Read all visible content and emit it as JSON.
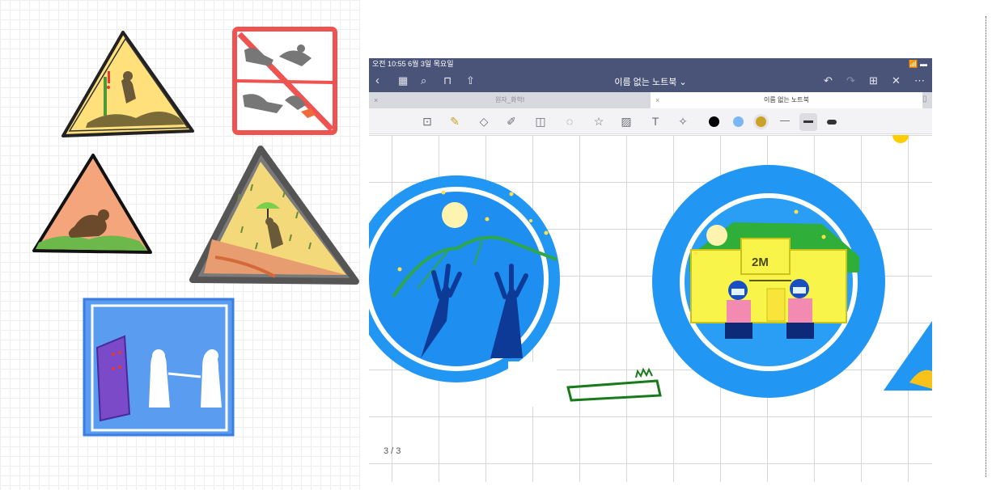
{
  "app": {
    "status_time": "오전 10:55  6월 3일 목요일",
    "status_right": "📶 ▬",
    "doc_title": "이름 없는 노트북 ⌄",
    "tabs": [
      {
        "label": "원자_화학I",
        "close": "×"
      },
      {
        "label": "이름 없는 노트북",
        "close": "×"
      }
    ],
    "page_counter": "3 / 3"
  },
  "nav_icons": {
    "left": [
      "back-icon",
      "grid-icon",
      "search-icon",
      "bookmark-icon",
      "share-icon"
    ],
    "right": [
      "undo-icon",
      "redo-icon",
      "add-page-icon",
      "pen-off-icon",
      "more-icon"
    ]
  },
  "toolbar_icons": [
    "page-view-icon",
    "pen-icon",
    "eraser-icon",
    "highlighter-icon",
    "shapes-icon",
    "lasso-icon",
    "sticker-icon",
    "image-icon",
    "text-icon",
    "laser-icon"
  ],
  "colors": {
    "ink_black": "#000000",
    "ink_blue": "#7ab8f5",
    "ink_gold": "#c9a227",
    "nav_bg": "#4a5478",
    "badge_blue": "#2196f3",
    "night_blue": "#1e63d8"
  }
}
